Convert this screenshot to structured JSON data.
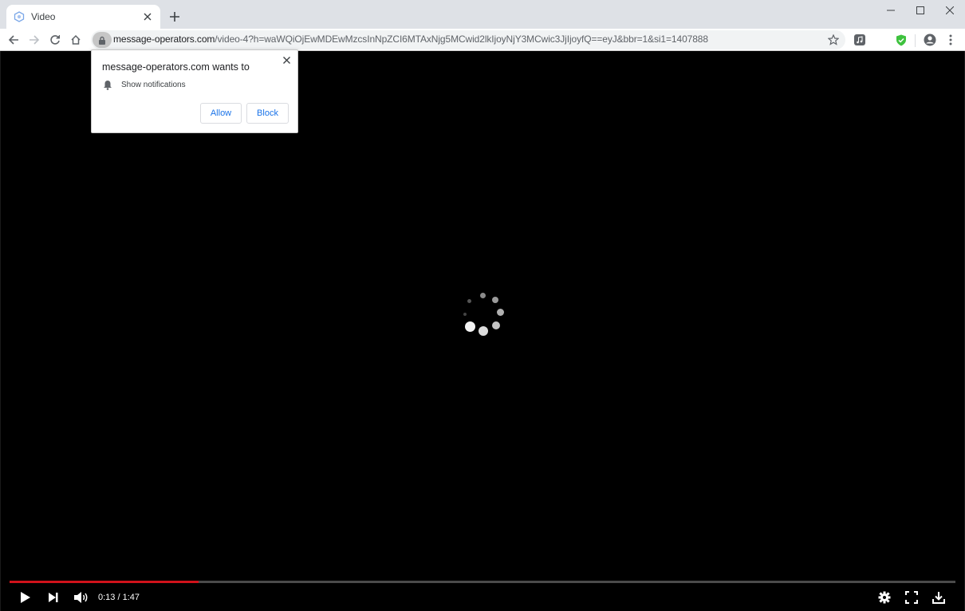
{
  "browser": {
    "tab": {
      "title": "Video",
      "favicon": "globe-icon"
    },
    "new_tab_label": "+",
    "window_controls": [
      "minimize",
      "maximize",
      "close"
    ],
    "nav": [
      "back",
      "forward",
      "reload",
      "home"
    ],
    "address": {
      "domain": "message-operators.com",
      "path": "/video-4?h=waWQiOjEwMDEwMzcsInNpZCI6MTAxNjg5MCwid2lkIjoyNjY3MCwic3JjIjoyfQ==eyJ&bbr=1&si1=1407888",
      "secure_icon": "lock-icon"
    },
    "extensions": [
      "music-extension",
      "shield-check-extension"
    ],
    "profile_icon": "account-icon",
    "menu_icon": "kebab-menu-icon"
  },
  "permission_popup": {
    "title": "message-operators.com wants to",
    "permission": "Show notifications",
    "permission_icon": "bell-icon",
    "allow_label": "Allow",
    "block_label": "Block"
  },
  "player": {
    "state": "buffering",
    "current_time": "0:13",
    "duration": "1:47",
    "time_display": "0:13 / 1:47",
    "progress_fraction": 0.2,
    "accent_color": "#d0121b",
    "controls_left": [
      "play",
      "next",
      "volume"
    ],
    "controls_right": [
      "settings",
      "fullscreen",
      "download"
    ]
  }
}
